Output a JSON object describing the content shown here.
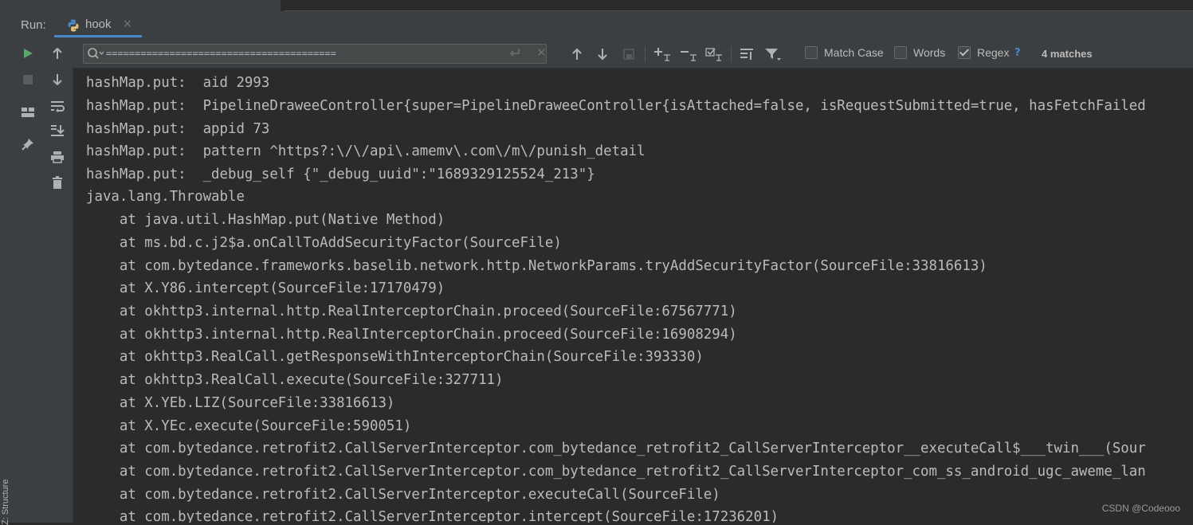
{
  "window": {
    "structure_label": "Z: Structure"
  },
  "runbar": {
    "label": "Run:",
    "tab_label": "hook",
    "tab_close": "×"
  },
  "search": {
    "query": "========================================",
    "match_case_label": "Match Case",
    "match_case_checked": false,
    "words_label": "Words",
    "words_checked": false,
    "regex_label": "Regex",
    "regex_checked": true,
    "help": "?",
    "match_count": "4 matches"
  },
  "console": {
    "lines": [
      "hashMap.put:  aid 2993",
      "hashMap.put:  PipelineDraweeController{super=PipelineDraweeController{isAttached=false, isRequestSubmitted=true, hasFetchFailed",
      "hashMap.put:  appid 73",
      "hashMap.put:  pattern ^https?:\\/\\/api\\.amemv\\.com\\/m\\/punish_detail",
      "hashMap.put:  _debug_self {\"_debug_uuid\":\"1689329125524_213\"}",
      "java.lang.Throwable",
      "    at java.util.HashMap.put(Native Method)",
      "    at ms.bd.c.j2$a.onCallToAddSecurityFactor(SourceFile)",
      "    at com.bytedance.frameworks.baselib.network.http.NetworkParams.tryAddSecurityFactor(SourceFile:33816613)",
      "    at X.Y86.intercept(SourceFile:17170479)",
      "    at okhttp3.internal.http.RealInterceptorChain.proceed(SourceFile:67567771)",
      "    at okhttp3.internal.http.RealInterceptorChain.proceed(SourceFile:16908294)",
      "    at okhttp3.RealCall.getResponseWithInterceptorChain(SourceFile:393330)",
      "    at okhttp3.RealCall.execute(SourceFile:327711)",
      "    at X.YEb.LIZ(SourceFile:33816613)",
      "    at X.YEc.execute(SourceFile:590051)",
      "    at com.bytedance.retrofit2.CallServerInterceptor.com_bytedance_retrofit2_CallServerInterceptor__executeCall$___twin___(Sour",
      "    at com.bytedance.retrofit2.CallServerInterceptor.com_bytedance_retrofit2_CallServerInterceptor_com_ss_android_ugc_aweme_lan",
      "    at com.bytedance.retrofit2.CallServerInterceptor.executeCall(SourceFile)",
      "    at com.bytedance.retrofit2.CallServerInterceptor.intercept(SourceFile:17236201)"
    ]
  },
  "watermark": "CSDN @Codeooo",
  "colors": {
    "panel": "#3c3f41",
    "console_bg": "#2b2b2b",
    "text": "#bbbbbb",
    "accent": "#4a88c7",
    "run_green": "#59a869"
  },
  "icons": {
    "toolbar_left": [
      "run-icon",
      "stop-icon",
      "layout-icon",
      "pin-icon"
    ],
    "toolbar_right": [
      "up-arrow-icon",
      "down-arrow-icon",
      "soft-wrap-icon",
      "scroll-to-end-icon",
      "print-icon",
      "trash-icon"
    ],
    "search": [
      "search-icon",
      "newline-icon",
      "clear-icon",
      "prev-occurrence-icon",
      "next-occurrence-icon",
      "select-all-icon",
      "add-selection-icon",
      "remove-selection-icon",
      "toggle-selection-icon",
      "filter-settings-icon",
      "filter-icon"
    ]
  }
}
